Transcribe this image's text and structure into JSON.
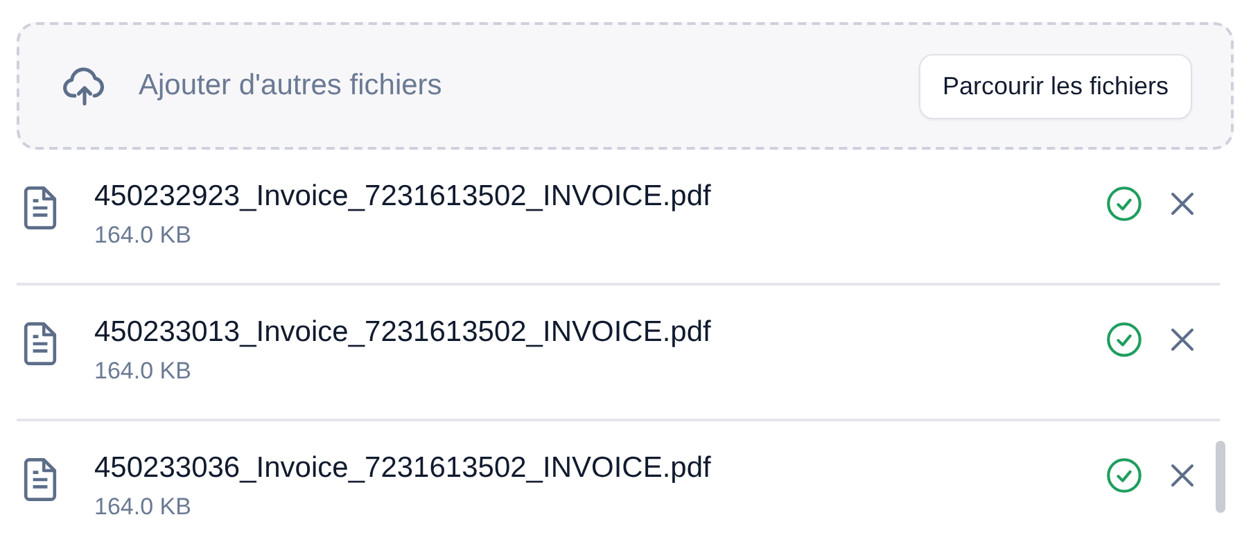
{
  "dropzone": {
    "label": "Ajouter d'autres fichiers",
    "button": "Parcourir les fichiers"
  },
  "files": [
    {
      "name": "450232923_Invoice_7231613502_INVOICE.pdf",
      "size": "164.0 KB",
      "uploaded": true
    },
    {
      "name": "450233013_Invoice_7231613502_INVOICE.pdf",
      "size": "164.0 KB",
      "uploaded": true
    },
    {
      "name": "450233036_Invoice_7231613502_INVOICE.pdf",
      "size": "164.0 KB",
      "uploaded": true
    }
  ]
}
